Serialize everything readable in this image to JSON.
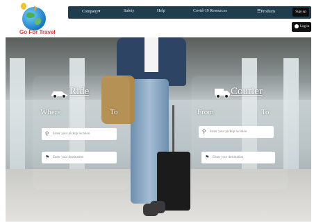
{
  "brand": {
    "name": "Go For Travel"
  },
  "nav": {
    "items": [
      {
        "label": "Company"
      },
      {
        "label": "Safety"
      },
      {
        "label": "Help"
      },
      {
        "label": "Covid-19 Resources"
      },
      {
        "label": "Products"
      }
    ],
    "signup_label": "Sign up",
    "login_label": "Log in"
  },
  "ride": {
    "title": "Ride",
    "where_label": "Where",
    "to_label": "To",
    "pickup_placeholder": "Enter your pickup location",
    "destination_placeholder": "Enter your destination"
  },
  "courier": {
    "title": "Courier",
    "from_label": "From",
    "to_label": "To",
    "pickup_placeholder": "Enter your pickup location",
    "destination_placeholder": "Enter your destination"
  },
  "colors": {
    "nav_bg": "#1f3d4c",
    "brand_text": "#e53935",
    "button_bg": "#111111"
  }
}
